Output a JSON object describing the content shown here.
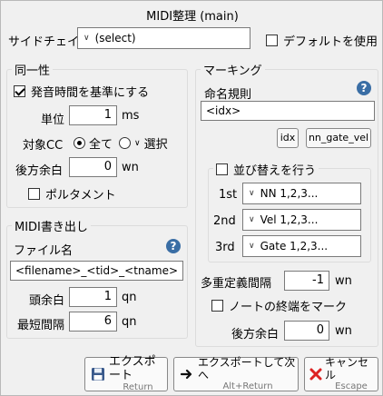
{
  "window": {
    "title": "MIDI整理 (main)"
  },
  "sidechain": {
    "label": "サイドチェイン",
    "value": "(select)",
    "default_label": "デフォルトを使用"
  },
  "douitsusei": {
    "title": "同一性",
    "onset_label": "発音時間を基準にする",
    "unit_label": "単位",
    "unit_value": "1",
    "unit_suffix": "ms",
    "target_label": "対象CC",
    "all_label": "全て",
    "select_label": "選択",
    "tail_label": "後方余白",
    "tail_value": "0",
    "tail_suffix": "wn",
    "portamento_label": "ポルタメント"
  },
  "midi_export": {
    "title": "MIDI書き出し",
    "filename_label": "ファイル名",
    "filename_value": "<filename>_<tid>_<tname>",
    "head_label": "頭余白",
    "head_value": "1",
    "head_suffix": "qn",
    "min_label": "最短間隔",
    "min_value": "6",
    "min_suffix": "qn"
  },
  "marking": {
    "title": "マーキング",
    "naming_label": "命名規則",
    "naming_value": "<idx>",
    "idx_button": "idx",
    "nn_gate_vel_button": "nn_gate_vel",
    "sort_label": "並び替えを行う",
    "first_label": "1st",
    "first_value": "NN 1,2,3...",
    "second_label": "2nd",
    "second_value": "Vel 1,2,3...",
    "third_label": "3rd",
    "third_value": "Gate 1,2,3...",
    "multidef_label": "多重定義間隔",
    "multidef_value": "-1",
    "multidef_suffix": "wn",
    "noteend_label": "ノートの終端をマーク",
    "tail_label": "後方余白",
    "tail_value": "0",
    "tail_suffix": "wn"
  },
  "buttons": {
    "export_label": "エクスポート",
    "export_sub": "Return",
    "export_next_label": "エクスポートして次へ",
    "export_next_sub": "Alt+Return",
    "cancel_label": "キャンセル",
    "cancel_sub": "Escape"
  },
  "icons": {
    "help": "question-icon",
    "chevron": "chevron-down-icon",
    "export": "floppy-icon",
    "export_next": "arrow-right-icon",
    "cancel": "close-x-icon"
  },
  "colors": {
    "help_blue": "#3a6ea5",
    "cancel_red": "#d22"
  }
}
